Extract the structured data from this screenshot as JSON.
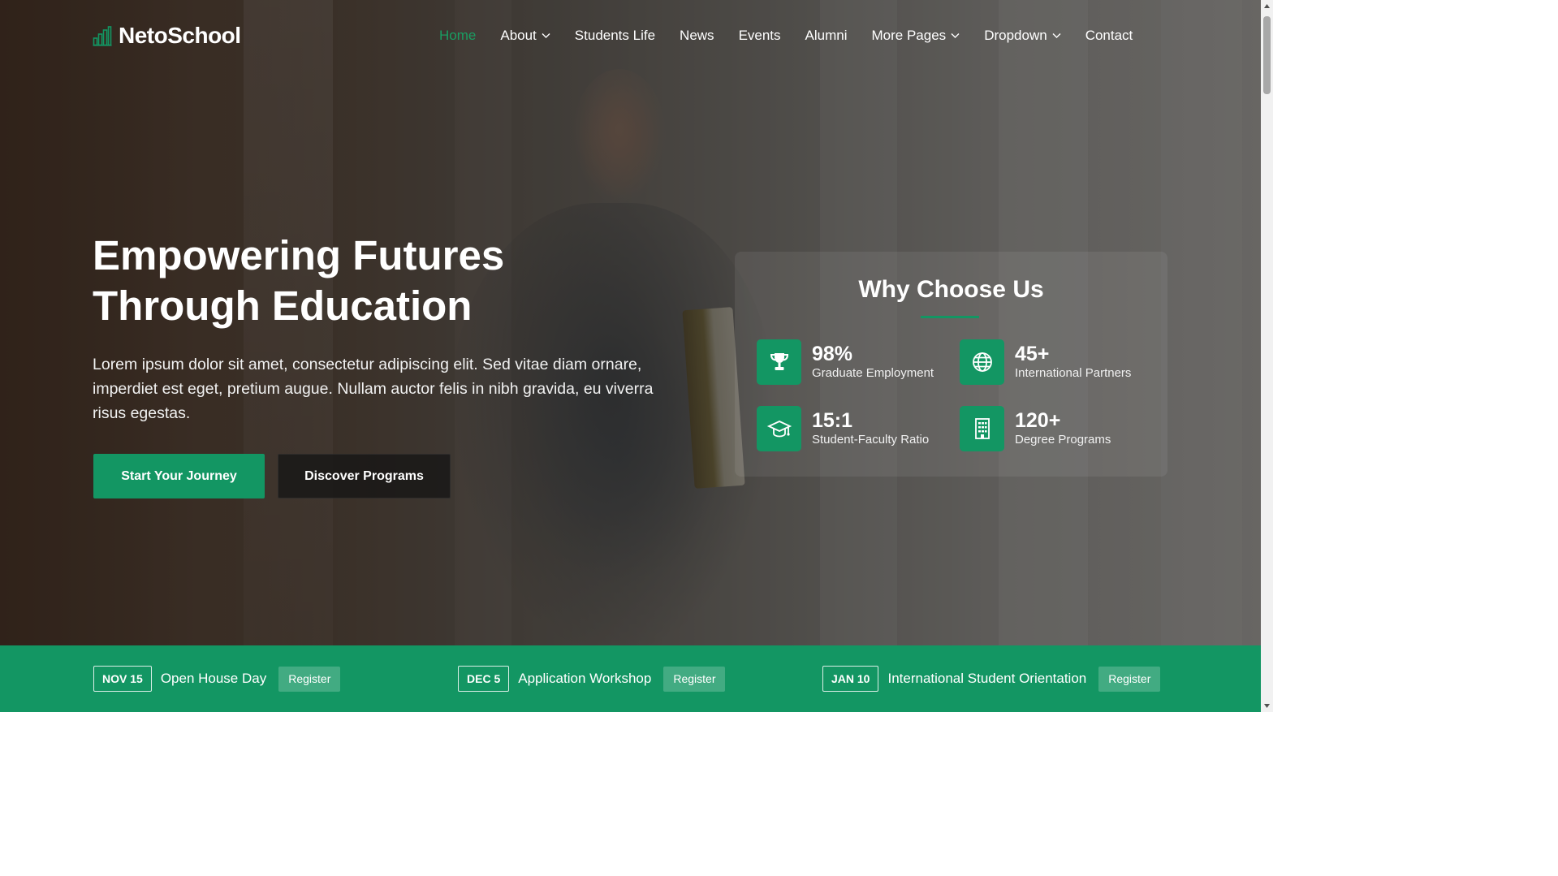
{
  "brand": {
    "name": "NetoSchool",
    "icon": "chart-building-icon",
    "accent": "#139663"
  },
  "nav": {
    "items": [
      {
        "label": "Home",
        "active": true,
        "dropdown": false
      },
      {
        "label": "About",
        "active": false,
        "dropdown": true
      },
      {
        "label": "Students Life",
        "active": false,
        "dropdown": false
      },
      {
        "label": "News",
        "active": false,
        "dropdown": false
      },
      {
        "label": "Events",
        "active": false,
        "dropdown": false
      },
      {
        "label": "Alumni",
        "active": false,
        "dropdown": false
      },
      {
        "label": "More Pages",
        "active": false,
        "dropdown": true
      },
      {
        "label": "Dropdown",
        "active": false,
        "dropdown": true
      },
      {
        "label": "Contact",
        "active": false,
        "dropdown": false
      }
    ]
  },
  "hero": {
    "title_line1": "Empowering Futures",
    "title_line2": "Through Education",
    "description": "Lorem ipsum dolor sit amet, consectetur adipiscing elit. Sed vitae diam ornare, imperdiet est eget, pretium augue. Nullam auctor felis in nibh gravida, eu viverra risus egestas.",
    "primary_button": "Start Your Journey",
    "secondary_button": "Discover Programs"
  },
  "why_choose": {
    "title": "Why Choose Us",
    "stats": [
      {
        "value": "98%",
        "label": "Graduate Employment",
        "icon": "trophy-icon"
      },
      {
        "value": "45+",
        "label": "International Partners",
        "icon": "globe-icon"
      },
      {
        "value": "15:1",
        "label": "Student-Faculty Ratio",
        "icon": "graduation-cap-icon"
      },
      {
        "value": "120+",
        "label": "Degree Programs",
        "icon": "building-icon"
      }
    ]
  },
  "events": [
    {
      "date": "NOV 15",
      "title": "Open House Day",
      "button": "Register"
    },
    {
      "date": "DEC 5",
      "title": "Application Workshop",
      "button": "Register"
    },
    {
      "date": "JAN 10",
      "title": "International Student Orientation",
      "button": "Register"
    }
  ]
}
